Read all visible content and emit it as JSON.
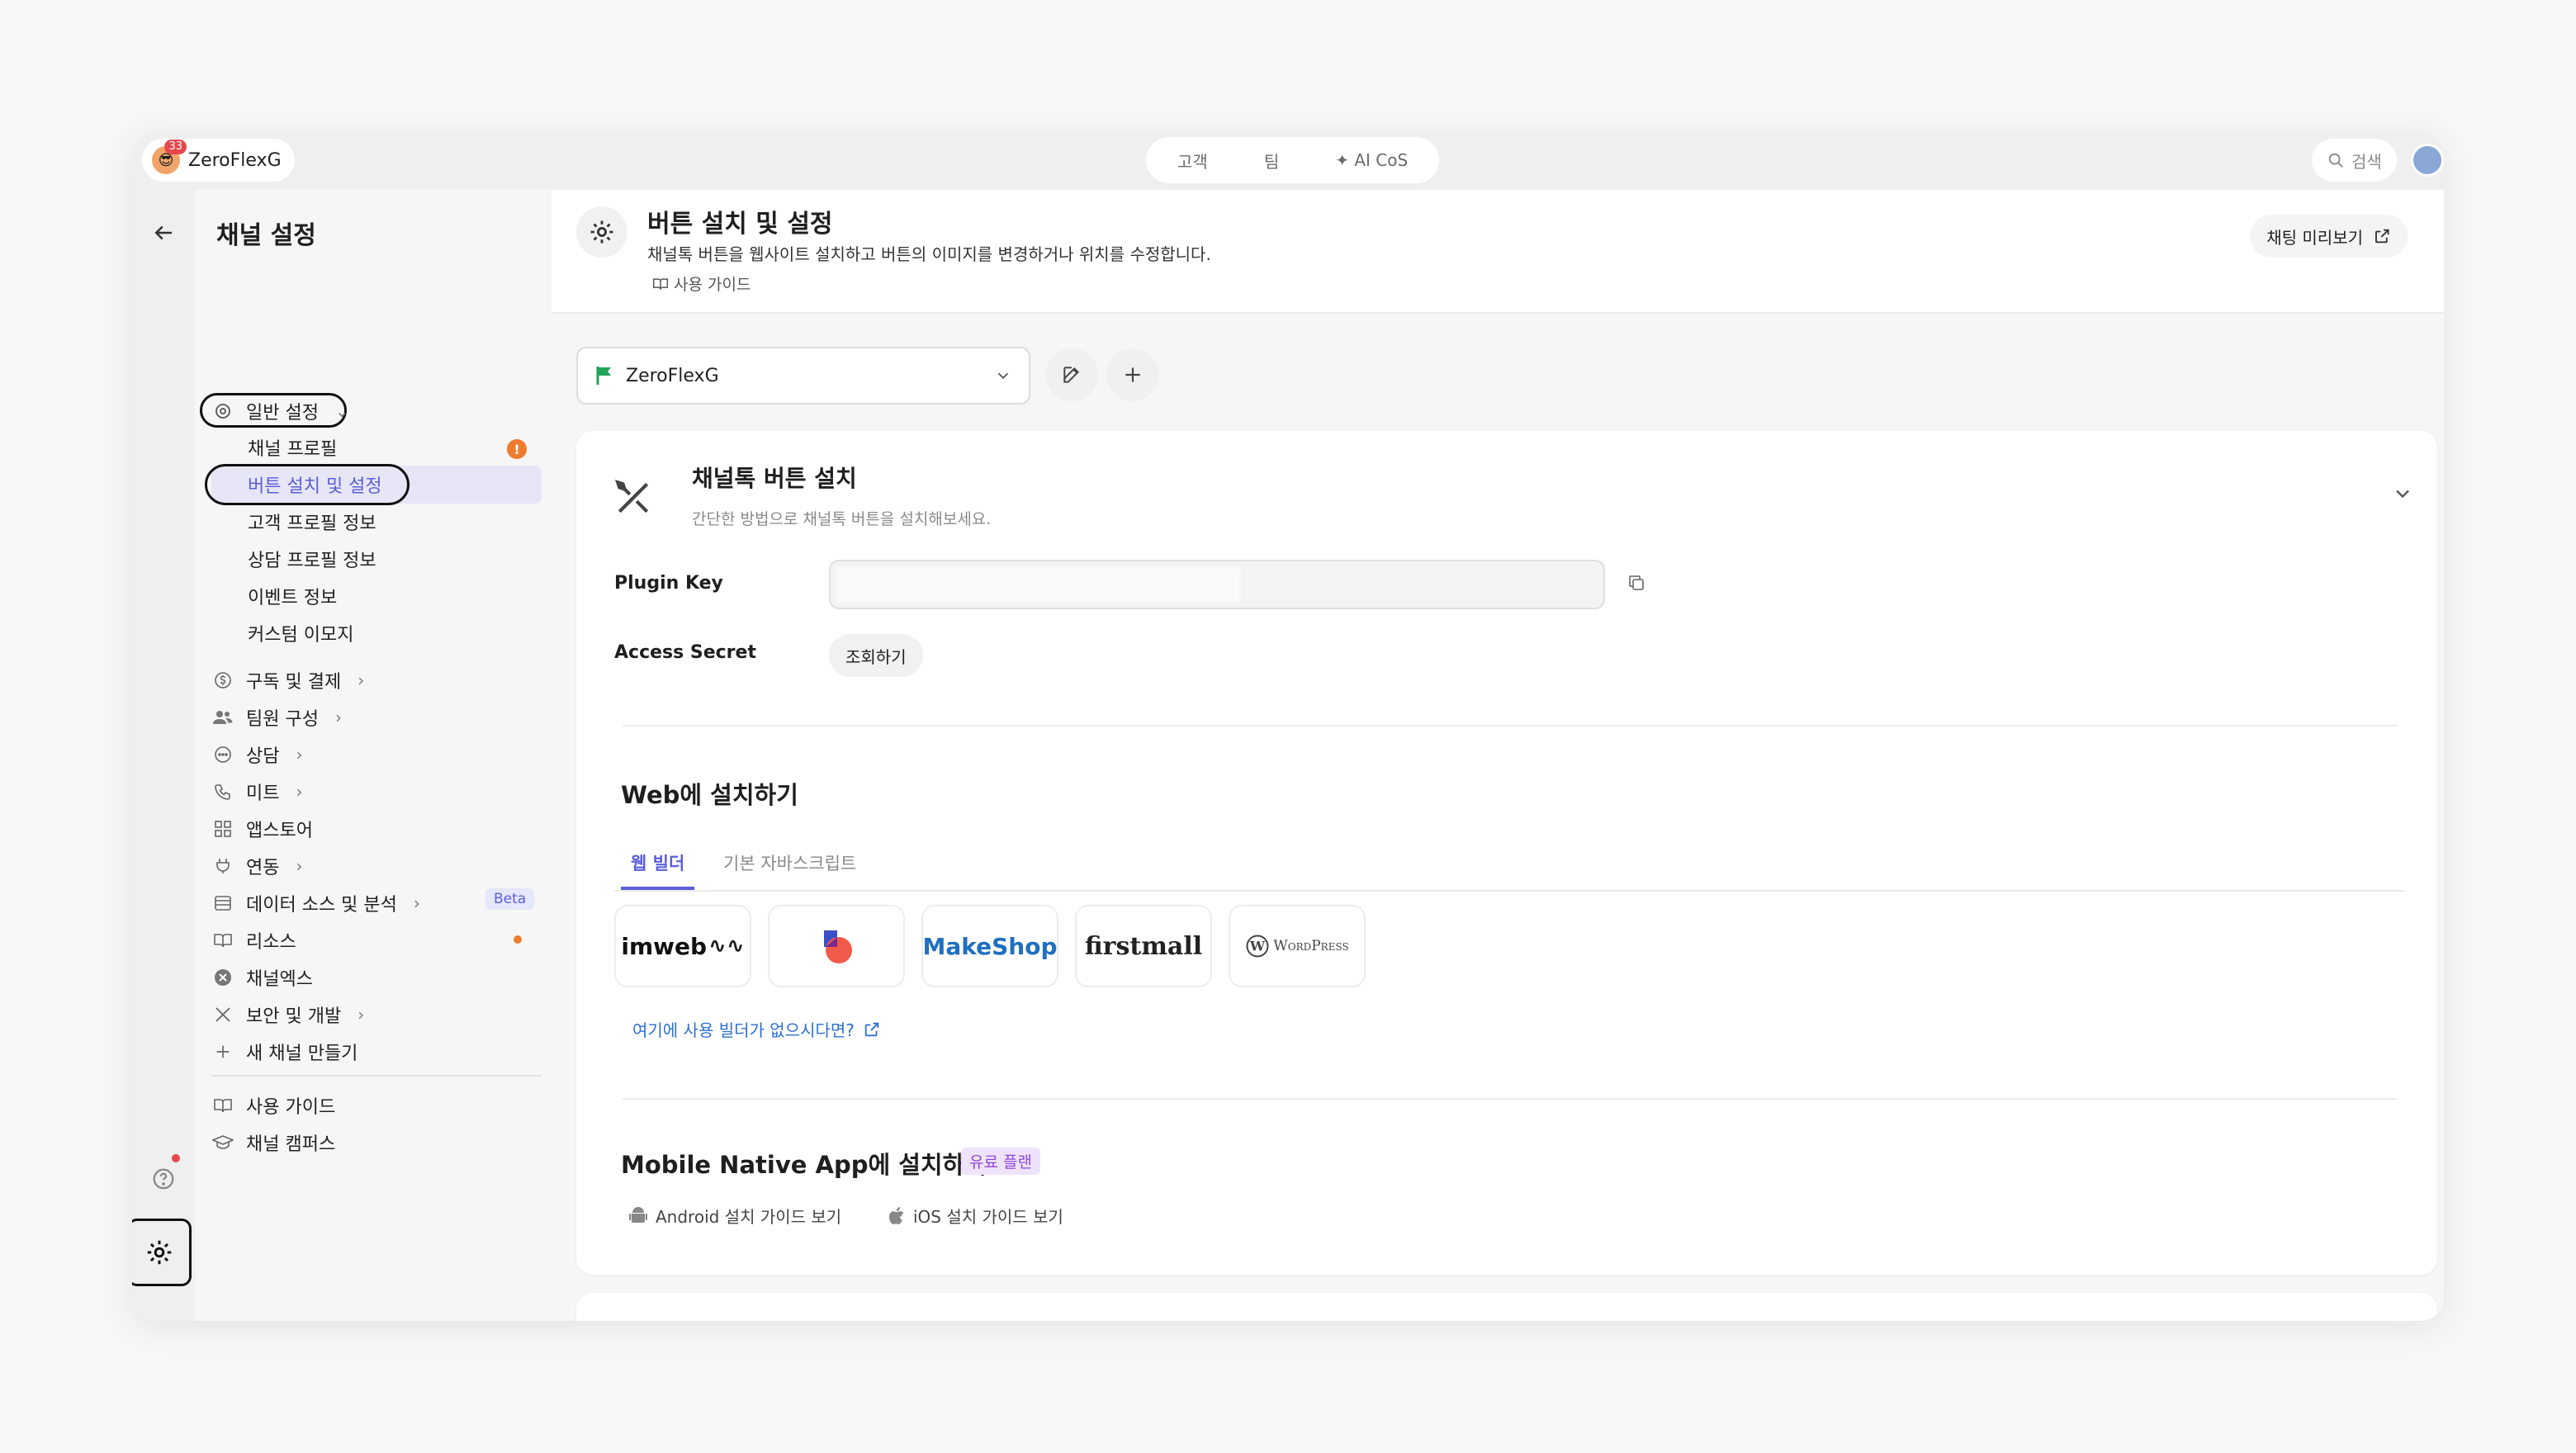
{
  "topbar": {
    "workspace_name": "ZeroFlexG",
    "notification_count": "33",
    "tabs": [
      "고객",
      "팀",
      "✦ AI CoS"
    ],
    "search_label": "검색"
  },
  "sidebar": {
    "title": "채널 설정",
    "general": "일반 설정",
    "sub_items": [
      "채널 프로필",
      "버튼 설치 및 설정",
      "고객 프로필 정보",
      "상담 프로필 정보",
      "이벤트 정보",
      "커스텀 이모지"
    ],
    "alert_mark": "!",
    "items": [
      "구독 및 결제",
      "팀원 구성",
      "상담",
      "미트",
      "앱스토어",
      "연동",
      "데이터 소스 및 분석",
      "리소스",
      "채널엑스",
      "보안 및 개발",
      "새 채널 만들기"
    ],
    "beta_label": "Beta",
    "bottom_items": [
      "사용 가이드",
      "채널 캠퍼스"
    ]
  },
  "header": {
    "title": "버튼 설치 및 설정",
    "description": "채널톡 버튼을 웹사이트 설치하고 버튼의 이미지를 변경하거나 위치를 수정합니다.",
    "guide_link": "사용 가이드",
    "preview_button": "채팅 미리보기"
  },
  "channel_select": {
    "value": "ZeroFlexG"
  },
  "install_card": {
    "title": "채널톡 버튼 설치",
    "subtitle": "간단한 방법으로 채널톡 버튼을 설치해보세요.",
    "plugin_key_label": "Plugin Key",
    "access_secret_label": "Access Secret",
    "lookup_button": "조회하기",
    "web_section_title": "Web에 설치하기",
    "tabs": [
      "웹 빌더",
      "기본 자바스크립트"
    ],
    "builders": [
      "imweb",
      "",
      "MakeShop",
      "firstmall",
      "WordPress"
    ],
    "no_builder_link": "여기에 사용 빌더가 없으시다면?",
    "mobile_section_title": "Mobile Native App에 설치하기",
    "paid_badge": "유료 플랜",
    "android_guide": "Android 설치 가이드 보기",
    "ios_guide": "iOS 설치 가이드 보기"
  },
  "colors": {
    "accent": "#5b5fd9",
    "link": "#2d6fd2",
    "alert": "#ee7b2e",
    "flag": "#22a35a"
  }
}
